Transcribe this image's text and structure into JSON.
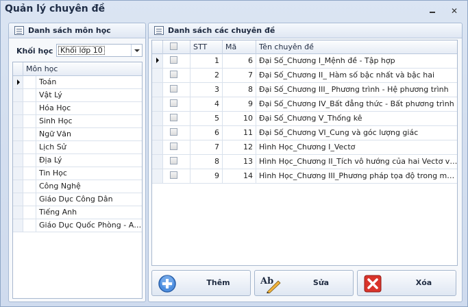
{
  "window": {
    "title": "Quản lý chuyên đề",
    "close_glyph": "✕"
  },
  "left_panel": {
    "header": "Danh sách môn học",
    "khoi_label": "Khối học :",
    "khoi_value": "Khối lớp 10",
    "column_header": "Môn học",
    "subjects": [
      "Toán",
      "Vật Lý",
      "Hóa Học",
      "Sinh Học",
      "Ngữ Văn",
      "Lịch Sử",
      "Địa Lý",
      "Tin Học",
      "Công Nghệ",
      "Giáo Dục Công Dân",
      "Tiếng Anh",
      "Giáo Dục Quốc Phòng - An ..."
    ],
    "current_index": 0
  },
  "right_panel": {
    "header": "Danh sách các chuyên đề",
    "columns": {
      "stt": "STT",
      "ma": "Mã",
      "ten": "Tên chuyên đề"
    },
    "rows": [
      {
        "stt": "1",
        "ma": "6",
        "ten": "Đại Số_Chương I_Mệnh đề - Tập hợp"
      },
      {
        "stt": "2",
        "ma": "7",
        "ten": "Đại Số_Chương II_ Hàm số bậc nhất và bậc hai"
      },
      {
        "stt": "3",
        "ma": "8",
        "ten": "Đại Số_Chương III_ Phương trình - Hệ phương trình"
      },
      {
        "stt": "4",
        "ma": "9",
        "ten": "Đại Số_Chương IV_Bất đẳng thức - Bất phương trình"
      },
      {
        "stt": "5",
        "ma": "10",
        "ten": "Đại Số_Chương V_Thống kê"
      },
      {
        "stt": "6",
        "ma": "11",
        "ten": "Đại Số_Chương VI_Cung và góc lượng giác"
      },
      {
        "stt": "7",
        "ma": "12",
        "ten": "Hình Học_Chương I_Vectơ"
      },
      {
        "stt": "8",
        "ma": "13",
        "ten": "Hình Học_Chương II_Tích vô hướng của hai Vectơ và ứng..."
      },
      {
        "stt": "9",
        "ma": "14",
        "ten": "Hình Học_Chương III_Phương pháp tọa độ trong mặt ph..."
      }
    ],
    "current_index": 0
  },
  "buttons": {
    "them": "Thêm",
    "sua": "Sửa",
    "xoa": "Xóa",
    "sua_icon_text": "Ab"
  },
  "colors": {
    "accent_blue": "#3d7fd6",
    "delete_red": "#d9342b"
  }
}
